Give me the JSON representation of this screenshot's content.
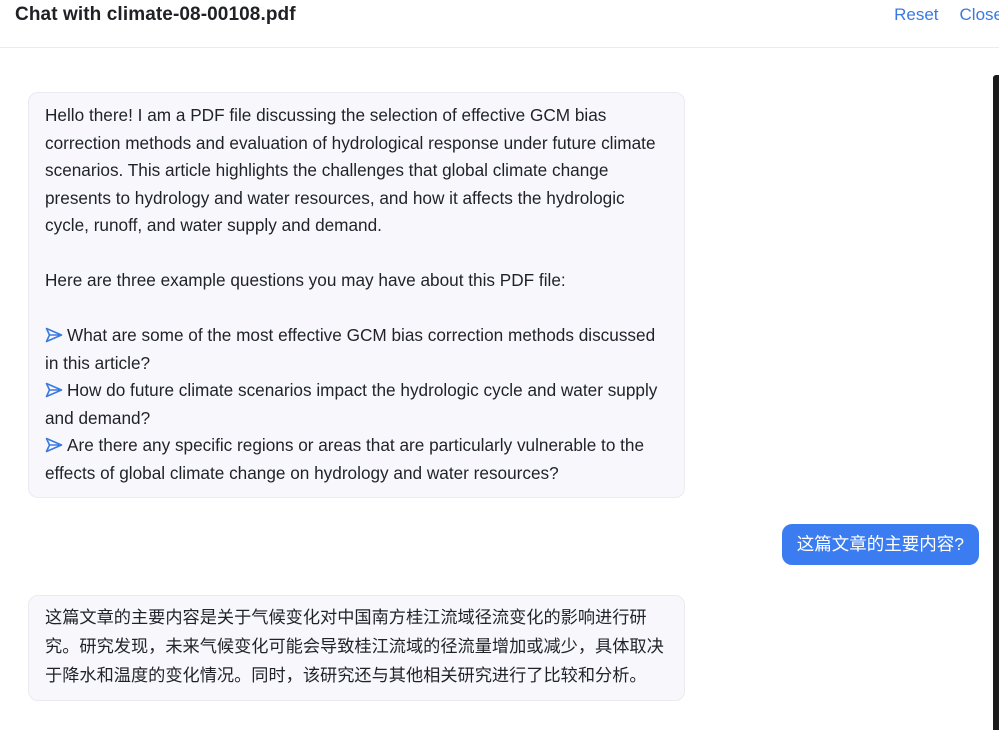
{
  "header": {
    "title": "Chat with climate-08-00108.pdf",
    "reset_label": "Reset",
    "close_label": "Close"
  },
  "messages": {
    "bot_intro": {
      "intro": "Hello there! I am a PDF file discussing the selection of effective GCM bias correction methods and evaluation of hydrological response under future climate scenarios. This article highlights the challenges that global climate change presents to hydrology and water resources, and how it affects the hydrologic cycle, runoff, and water supply and demand.",
      "questions_lead": "Here are three example questions you may have about this PDF file:",
      "questions": [
        "What are some of the most effective GCM bias correction methods discussed in this article?",
        "How do future climate scenarios impact the hydrologic cycle and water supply and demand?",
        "Are there any specific regions or areas that are particularly vulnerable to the effects of global climate change on hydrology and water resources?"
      ],
      "question_icon": "send-arrow-icon"
    },
    "user_question": "这篇文章的主要内容?",
    "bot_answer": "这篇文章的主要内容是关于气候变化对中国南方桂江流域径流变化的影响进行研究。研究发现，未来气候变化可能会导致桂江流域的径流量增加或减少，具体取决于降水和温度的变化情况。同时，该研究还与其他相关研究进行了比较和分析。"
  },
  "colors": {
    "accent": "#3b7cf0",
    "link": "#3a7ae0",
    "bot_bubble_bg": "#f8f7fc"
  }
}
